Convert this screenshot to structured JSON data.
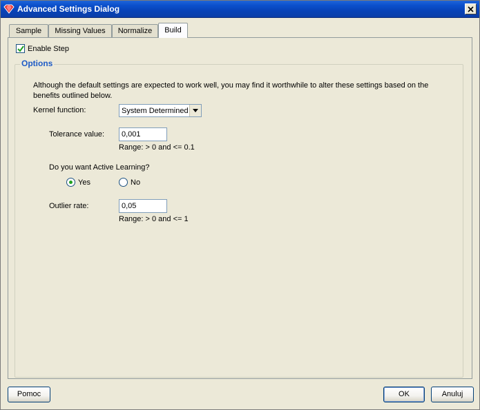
{
  "window": {
    "title": "Advanced Settings Dialog"
  },
  "tabs": [
    {
      "label": "Sample"
    },
    {
      "label": "Missing Values"
    },
    {
      "label": "Normalize"
    },
    {
      "label": "Build"
    }
  ],
  "active_tab": "Build",
  "enable_step": {
    "label": "Enable Step",
    "checked": true
  },
  "options": {
    "legend": "Options",
    "description": "Although the default settings are expected to work well, you may find it worthwhile to alter these settings based on the benefits outlined below.",
    "kernel": {
      "label": "Kernel function:",
      "value": "System Determined"
    },
    "tolerance": {
      "label": "Tolerance value:",
      "value": "0,001",
      "range": "Range: > 0 and <= 0.1"
    },
    "active_learning": {
      "question": "Do you want Active Learning?",
      "yes_label": "Yes",
      "no_label": "No",
      "selected": "Yes"
    },
    "outlier": {
      "label": "Outlier rate:",
      "value": "0,05",
      "range": "Range: > 0 and <= 1"
    }
  },
  "buttons": {
    "help": "Pomoc",
    "ok": "OK",
    "cancel": "Anuluj"
  },
  "colors": {
    "titlebar": "#0a4fcb",
    "legend": "#1e5bc6",
    "radio_dot": "#21a121",
    "check": "#21a121"
  }
}
